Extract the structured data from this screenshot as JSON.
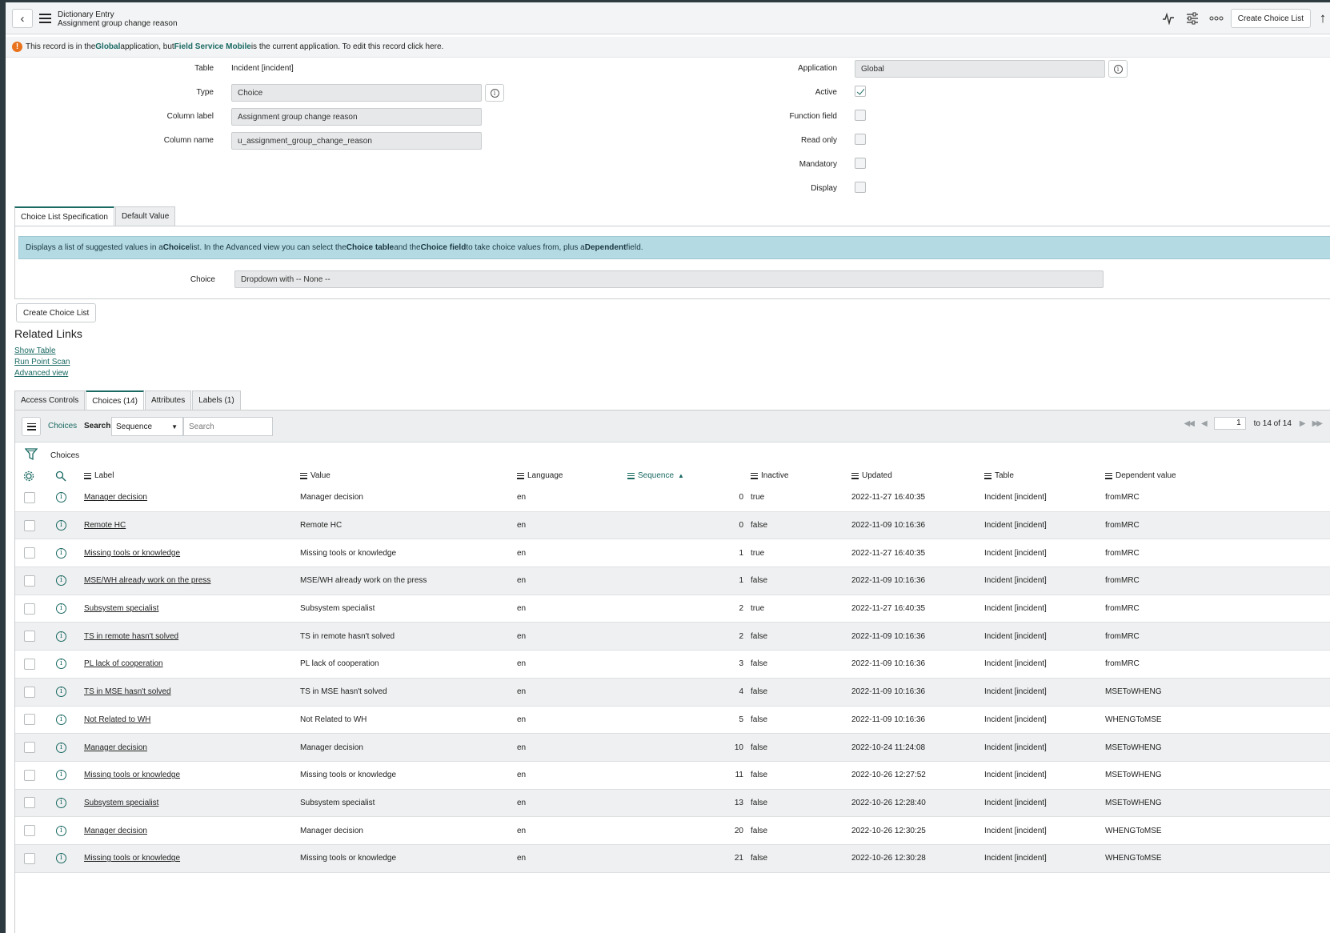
{
  "header": {
    "title": "Dictionary Entry",
    "subtitle": "Assignment group change reason",
    "create_choice_list_label": "Create Choice List"
  },
  "banner": {
    "part1": "This record is in the ",
    "app_name": "Global",
    "part2": " application, but ",
    "current_app": "Field Service Mobile",
    "part3": " is the current application. To edit this record click here."
  },
  "form": {
    "table_label": "Table",
    "table_value": "Incident [incident]",
    "type_label": "Type",
    "type_value": "Choice",
    "column_label_label": "Column label",
    "column_label_value": "Assignment group change reason",
    "column_name_label": "Column name",
    "column_name_value": "u_assignment_group_change_reason",
    "application_label": "Application",
    "application_value": "Global",
    "active_label": "Active",
    "active": true,
    "function_field_label": "Function field",
    "read_only_label": "Read only",
    "mandatory_label": "Mandatory",
    "display_label": "Display"
  },
  "form_tabs": {
    "tab1": "Choice List Specification",
    "tab2": "Default Value",
    "desc_1": "Displays a list of suggested values in a ",
    "desc_b1": "Choice",
    "desc_2": " list. In the Advanced view you can select the ",
    "desc_b2": "Choice table",
    "desc_3": " and the ",
    "desc_b3": "Choice field",
    "desc_4": " to take choice values from, plus a ",
    "desc_b4": "Dependent",
    "desc_5": " field.",
    "choice_label": "Choice",
    "choice_value": "Dropdown with -- None --"
  },
  "create_choice_list_button": "Create Choice List",
  "related_links": {
    "title": "Related Links",
    "show_table": "Show Table",
    "run_point_scan": "Run Point Scan",
    "advanced_view": "Advanced view"
  },
  "related_tabs": {
    "access_controls": "Access Controls",
    "choices": "Choices (14)",
    "attributes": "Attributes",
    "labels": "Labels (1)"
  },
  "list": {
    "title": "Choices",
    "search_label": "Search",
    "search_field": "Sequence",
    "search_placeholder": "Search",
    "page_value": "1",
    "page_total": "to 14 of 14",
    "filter_label": "Choices",
    "columns": {
      "label": "Label",
      "value": "Value",
      "language": "Language",
      "sequence": "Sequence",
      "inactive": "Inactive",
      "updated": "Updated",
      "table": "Table",
      "dependent": "Dependent value"
    },
    "rows": [
      {
        "label": "Manager decision",
        "value": "Manager decision",
        "language": "en",
        "sequence": "0",
        "inactive": "true",
        "updated": "2022-11-27 16:40:35",
        "table": "Incident [incident]",
        "dependent": "fromMRC"
      },
      {
        "label": "Remote HC",
        "value": "Remote HC",
        "language": "en",
        "sequence": "0",
        "inactive": "false",
        "updated": "2022-11-09 10:16:36",
        "table": "Incident [incident]",
        "dependent": "fromMRC"
      },
      {
        "label": "Missing tools or knowledge",
        "value": "Missing tools or knowledge",
        "language": "en",
        "sequence": "1",
        "inactive": "true",
        "updated": "2022-11-27 16:40:35",
        "table": "Incident [incident]",
        "dependent": "fromMRC"
      },
      {
        "label": "MSE/WH already work on the press",
        "value": "MSE/WH already work on the press",
        "language": "en",
        "sequence": "1",
        "inactive": "false",
        "updated": "2022-11-09 10:16:36",
        "table": "Incident [incident]",
        "dependent": "fromMRC"
      },
      {
        "label": "Subsystem specialist",
        "value": "Subsystem specialist",
        "language": "en",
        "sequence": "2",
        "inactive": "true",
        "updated": "2022-11-27 16:40:35",
        "table": "Incident [incident]",
        "dependent": "fromMRC"
      },
      {
        "label": "TS in remote hasn't solved",
        "value": "TS in remote hasn't solved",
        "language": "en",
        "sequence": "2",
        "inactive": "false",
        "updated": "2022-11-09 10:16:36",
        "table": "Incident [incident]",
        "dependent": "fromMRC"
      },
      {
        "label": "PL lack of cooperation",
        "value": "PL lack of cooperation",
        "language": "en",
        "sequence": "3",
        "inactive": "false",
        "updated": "2022-11-09 10:16:36",
        "table": "Incident [incident]",
        "dependent": "fromMRC"
      },
      {
        "label": "TS in MSE hasn't solved",
        "value": "TS in MSE hasn't solved",
        "language": "en",
        "sequence": "4",
        "inactive": "false",
        "updated": "2022-11-09 10:16:36",
        "table": "Incident [incident]",
        "dependent": "MSEToWHENG"
      },
      {
        "label": "Not Related to WH",
        "value": "Not Related to WH",
        "language": "en",
        "sequence": "5",
        "inactive": "false",
        "updated": "2022-11-09 10:16:36",
        "table": "Incident [incident]",
        "dependent": "WHENGToMSE"
      },
      {
        "label": "Manager decision",
        "value": "Manager decision",
        "language": "en",
        "sequence": "10",
        "inactive": "false",
        "updated": "2022-10-24 11:24:08",
        "table": "Incident [incident]",
        "dependent": "MSEToWHENG"
      },
      {
        "label": "Missing tools or knowledge",
        "value": "Missing tools or knowledge",
        "language": "en",
        "sequence": "11",
        "inactive": "false",
        "updated": "2022-10-26 12:27:52",
        "table": "Incident [incident]",
        "dependent": "MSEToWHENG"
      },
      {
        "label": "Subsystem specialist",
        "value": "Subsystem specialist",
        "language": "en",
        "sequence": "13",
        "inactive": "false",
        "updated": "2022-10-26 12:28:40",
        "table": "Incident [incident]",
        "dependent": "MSEToWHENG"
      },
      {
        "label": "Manager decision",
        "value": "Manager decision",
        "language": "en",
        "sequence": "20",
        "inactive": "false",
        "updated": "2022-10-26 12:30:25",
        "table": "Incident [incident]",
        "dependent": "WHENGToMSE"
      },
      {
        "label": "Missing tools or knowledge",
        "value": "Missing tools or knowledge",
        "language": "en",
        "sequence": "21",
        "inactive": "false",
        "updated": "2022-10-26 12:30:28",
        "table": "Incident [incident]",
        "dependent": "WHENGToMSE"
      }
    ]
  },
  "colors": {
    "accent": "#1a6a63",
    "info_bar": "#b4dbe4",
    "warning": "#e9731d"
  }
}
